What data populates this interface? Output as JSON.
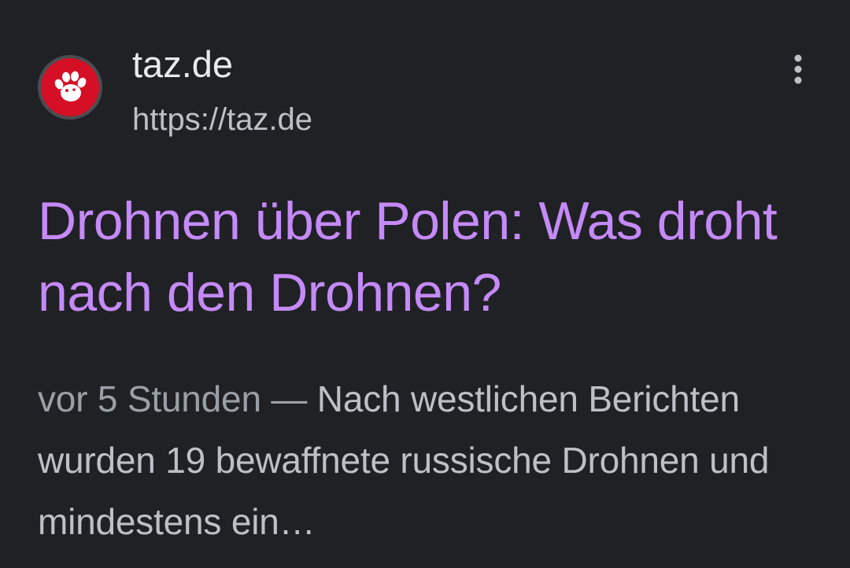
{
  "result": {
    "favicon_icon": "taz-paw-icon",
    "site_name": "taz.de",
    "site_url": "https://taz.de",
    "menu_icon": "more-vertical-icon",
    "title": "Drohnen über Polen: Was droht nach den Drohnen?",
    "snippet_date": "vor 5 Stunden",
    "snippet_separator": " — ",
    "snippet_text": "Nach westlichen Berichten wurden 19 bewaffnete russische Drohnen und mindestens ein…"
  },
  "colors": {
    "background": "#202124",
    "title_link": "#c58af9",
    "site_name": "#e8eaed",
    "url": "#bdc1c6",
    "favicon_red": "#d50f25"
  }
}
